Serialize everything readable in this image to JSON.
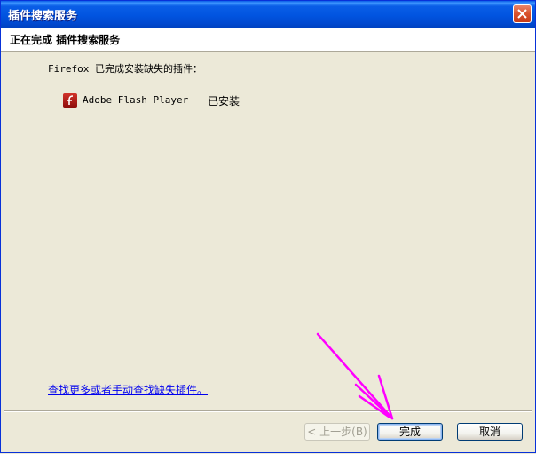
{
  "window": {
    "title": "插件搜索服务"
  },
  "header": {
    "title": "正在完成 插件搜索服务"
  },
  "content": {
    "intro": "Firefox 已完成安装缺失的插件：",
    "plugins": [
      {
        "name": "Adobe Flash Player",
        "status": "已安装",
        "icon": "flash-player-icon"
      }
    ],
    "more_link": "查找更多或者手动查找缺失插件。"
  },
  "buttons": {
    "back": "< 上一步(B)",
    "finish": "完成",
    "cancel": "取消"
  },
  "colors": {
    "titlebar": "#0a5ee7",
    "window_bg": "#ece9d8",
    "annotation_arrow": "#ff00ff"
  }
}
